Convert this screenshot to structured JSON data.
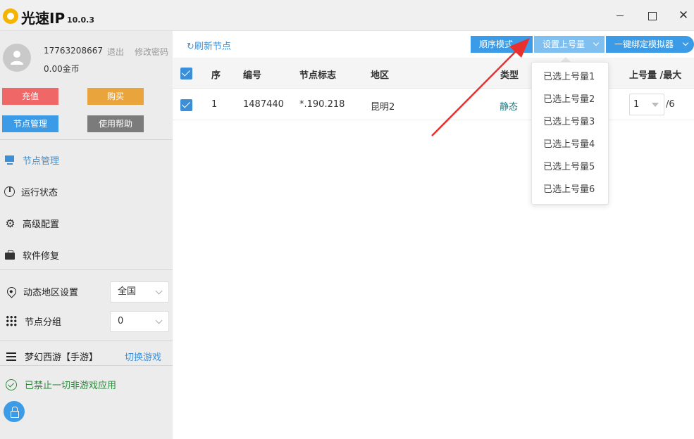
{
  "app": {
    "name": "光速IP",
    "version": "10.0.3"
  },
  "window": {
    "close_glyph": "✕"
  },
  "user": {
    "phone": "17763208667",
    "logout": "退出",
    "change_password": "修改密码",
    "coins": "0.00金币"
  },
  "sidebar": {
    "buttons": {
      "recharge": "充值",
      "buy": "购买",
      "node_manage": "节点管理",
      "help": "使用帮助"
    },
    "nav": [
      {
        "label": "节点管理",
        "icon": "monitor-icon"
      },
      {
        "label": "运行状态",
        "icon": "pie-chart-icon"
      },
      {
        "label": "高级配置",
        "icon": "gear-icon"
      },
      {
        "label": "软件修复",
        "icon": "briefcase-icon"
      }
    ],
    "dynamic_region": {
      "label": "动态地区设置",
      "value": "全国"
    },
    "node_group": {
      "label": "节点分组",
      "value": "0"
    },
    "game": {
      "name": "梦幻西游【手游】",
      "switch": "切换游戏"
    },
    "blocked_status": "已禁止一切非游戏应用"
  },
  "toolbar": {
    "refresh": "刷新节点",
    "order_mode": "顺序模式",
    "set_quantity": "设置上号量",
    "bind_emulator": "一键绑定模拟器"
  },
  "table": {
    "headers": {
      "index": "序",
      "number": "编号",
      "node_flag": "节点标志",
      "region": "地区",
      "type": "类型",
      "quantity": "上号量 /最大"
    },
    "rows": [
      {
        "index": "1",
        "number": "1487440",
        "node_flag": "*.190.218",
        "region": "昆明2",
        "type": "静态",
        "quantity": "1",
        "max": "/6"
      }
    ]
  },
  "dropdown": {
    "items": [
      "已选上号量1",
      "已选上号量2",
      "已选上号量3",
      "已选上号量4",
      "已选上号量5",
      "已选上号量6"
    ]
  },
  "colors": {
    "accent": "#3b9be6",
    "annotation_arrow": "#e8312e"
  }
}
